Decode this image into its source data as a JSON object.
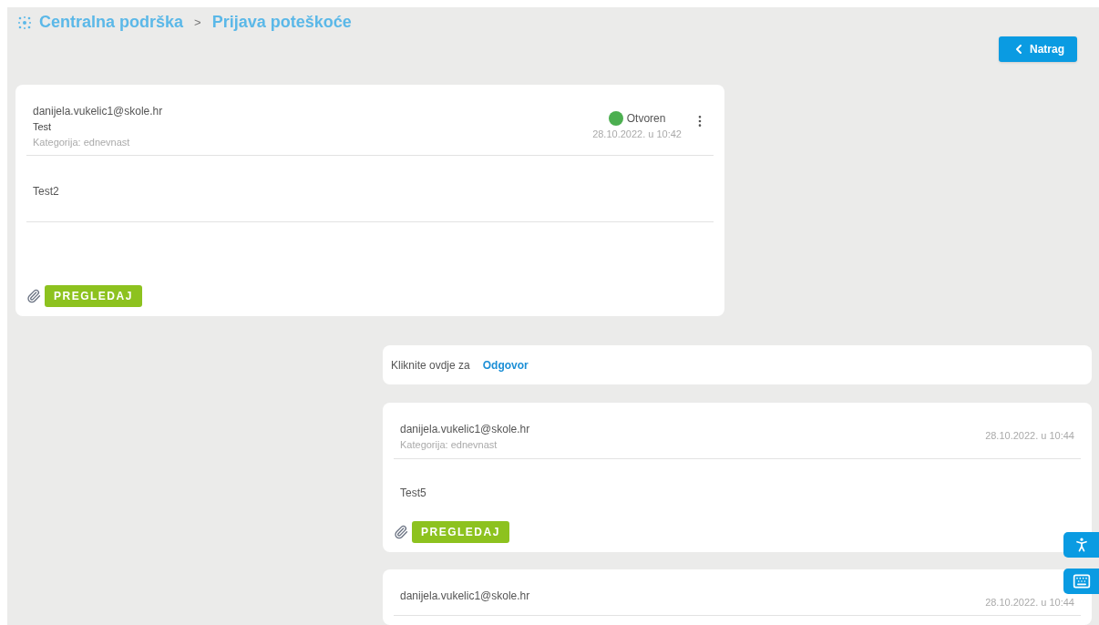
{
  "breadcrumb": {
    "items": [
      "Centralna podrška",
      "Prijava poteškoće"
    ],
    "separator": ">"
  },
  "back_button": {
    "label": "Natrag"
  },
  "ticket": {
    "author": "danijela.vukelic1@skole.hr",
    "title": "Test",
    "category": "Kategorija: ednevnast",
    "status": {
      "label": "Otvoren",
      "color": "#4caf50"
    },
    "date": "28.10.2022. u 10:42",
    "body": "Test2",
    "attachment_button": "PREGLEDAJ"
  },
  "reply_prompt": {
    "text": "Kliknite ovdje za",
    "link": "Odgovor"
  },
  "replies": [
    {
      "author": "danijela.vukelic1@skole.hr",
      "category": "Kategorija: ednevnast",
      "date": "28.10.2022. u 10:44",
      "body": "Test5",
      "attachment_button": "PREGLEDAJ"
    },
    {
      "author": "danijela.vukelic1@skole.hr",
      "date": "28.10.2022. u 10:44"
    }
  ]
}
